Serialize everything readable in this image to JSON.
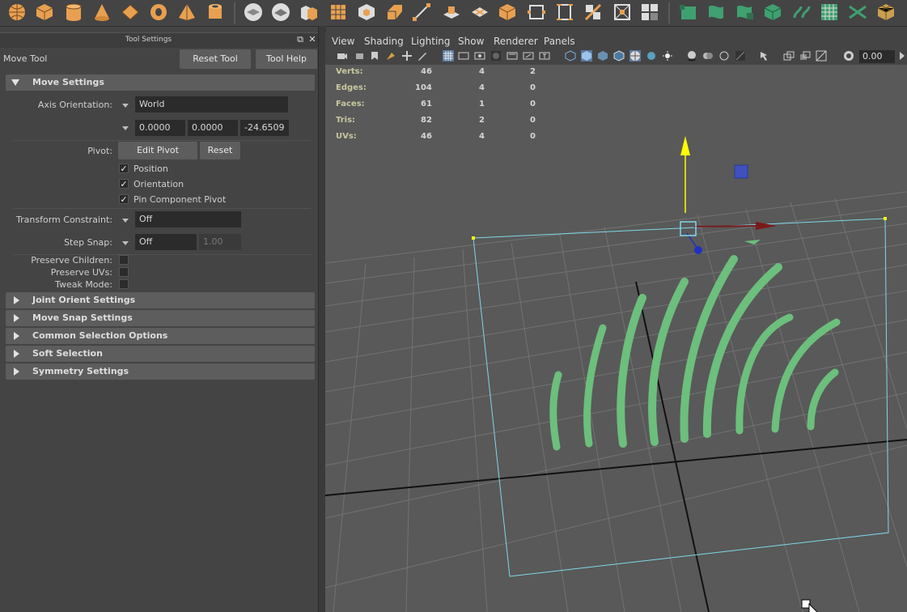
{
  "shelf": {
    "icons": [
      "sphere-icon",
      "cube-icon",
      "cylinder-icon",
      "cone-icon",
      "plane-icon",
      "torus-icon",
      "pyramid-icon",
      "pipe-icon",
      "smooth-icon",
      "mirror-icon",
      "combine-icon",
      "extract-icon",
      "boolean-icon",
      "bevel-icon",
      "bridge-icon",
      "extrude-icon",
      "multicut-icon",
      "append-icon",
      "fill-hole-icon",
      "triangulate-icon",
      "quadrangulate-icon",
      "target-weld-icon",
      "insert-edge-loop-icon",
      "offset-edge-loop-icon",
      "separate-icon",
      "uv-editor-icon",
      "unfold-icon",
      "cut-uv-icon",
      "sew-uv-icon",
      "planar-map-icon",
      "automatic-map-icon",
      "checker-icon",
      "layout-uv-icon",
      "texture-icon"
    ]
  },
  "left_panel": {
    "title": "Tool Settings",
    "tool_name": "Move Tool",
    "reset_tool": "Reset Tool",
    "tool_help": "Tool Help",
    "sections": {
      "move_settings": "Move Settings",
      "joint_orient": "Joint Orient Settings",
      "move_snap": "Move Snap Settings",
      "common_selection": "Common Selection Options",
      "soft_selection": "Soft Selection",
      "symmetry": "Symmetry Settings"
    },
    "axis_orientation_label": "Axis Orientation:",
    "axis_orientation_value": "World",
    "axis_values": [
      "0.0000",
      "0.0000",
      "-24.6509"
    ],
    "pivot_label": "Pivot:",
    "edit_pivot": "Edit Pivot",
    "reset": "Reset",
    "checkboxes": [
      {
        "label": "Position",
        "checked": true
      },
      {
        "label": "Orientation",
        "checked": true
      },
      {
        "label": "Pin Component Pivot",
        "checked": true
      }
    ],
    "transform_constraint_label": "Transform Constraint:",
    "transform_constraint_value": "Off",
    "step_snap_label": "Step Snap:",
    "step_snap_value": "Off",
    "step_snap_amount": "1.00",
    "preserve_children": "Preserve Children:",
    "preserve_uvs": "Preserve UVs:",
    "tweak_mode": "Tweak Mode:"
  },
  "viewport": {
    "menu": [
      "View",
      "Shading",
      "Lighting",
      "Show",
      "Renderer",
      "Panels"
    ],
    "field_value": "0.00",
    "hud": [
      {
        "label": "Verts:",
        "values": [
          "46",
          "4",
          "2"
        ]
      },
      {
        "label": "Edges:",
        "values": [
          "104",
          "4",
          "0"
        ]
      },
      {
        "label": "Faces:",
        "values": [
          "61",
          "1",
          "0"
        ]
      },
      {
        "label": "Tris:",
        "values": [
          "82",
          "2",
          "0"
        ]
      },
      {
        "label": "UVs:",
        "values": [
          "46",
          "4",
          "0"
        ]
      }
    ]
  },
  "colors": {
    "accent": "#5a7aa0",
    "grass": "#6cbf7c",
    "selection": "#7fd7ea",
    "gizmo_y": "#ffff00",
    "gizmo_x": "#7a1a1a",
    "gizmo_z": "#2030c0"
  }
}
